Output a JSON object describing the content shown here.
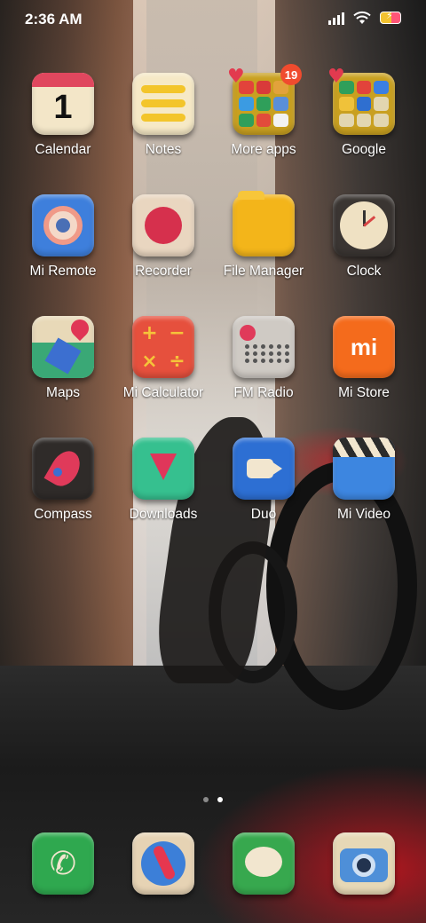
{
  "status_bar": {
    "time": "2:36 AM",
    "icons": [
      "signal-icon",
      "wifi-icon",
      "battery-charging-icon"
    ]
  },
  "home": {
    "rows": [
      [
        {
          "id": "calendar",
          "label": "Calendar",
          "icon": "calendar-icon",
          "calendar_day": "1"
        },
        {
          "id": "notes",
          "label": "Notes",
          "icon": "notes-icon"
        },
        {
          "id": "more-apps",
          "label": "More apps",
          "icon": "folder-icon",
          "badge": "19"
        },
        {
          "id": "google",
          "label": "Google",
          "icon": "folder-icon"
        }
      ],
      [
        {
          "id": "mi-remote",
          "label": "Mi Remote",
          "icon": "remote-icon"
        },
        {
          "id": "recorder",
          "label": "Recorder",
          "icon": "recorder-icon"
        },
        {
          "id": "file-manager",
          "label": "File Manager",
          "icon": "folder-files-icon"
        },
        {
          "id": "clock",
          "label": "Clock",
          "icon": "clock-icon"
        }
      ],
      [
        {
          "id": "maps",
          "label": "Maps",
          "icon": "maps-icon"
        },
        {
          "id": "mi-calculator",
          "label": "Mi Calculator",
          "icon": "calculator-icon"
        },
        {
          "id": "fm-radio",
          "label": "FM Radio",
          "icon": "radio-icon"
        },
        {
          "id": "mi-store",
          "label": "Mi Store",
          "icon": "mi-store-icon",
          "logo_text": "mi"
        }
      ],
      [
        {
          "id": "compass",
          "label": "Compass",
          "icon": "compass-icon"
        },
        {
          "id": "downloads",
          "label": "Downloads",
          "icon": "download-icon"
        },
        {
          "id": "duo",
          "label": "Duo",
          "icon": "video-call-icon"
        },
        {
          "id": "mi-video",
          "label": "Mi Video",
          "icon": "clapperboard-icon"
        }
      ]
    ]
  },
  "dock": [
    {
      "id": "phone",
      "icon": "phone-icon"
    },
    {
      "id": "browser",
      "icon": "compass-browser-icon"
    },
    {
      "id": "messaging",
      "icon": "message-icon"
    },
    {
      "id": "camera",
      "icon": "camera-icon"
    }
  ],
  "page_indicator": {
    "pages": 2,
    "current": 2
  },
  "colors": {
    "dot_inactive": "#8a8a8a",
    "dot_active": "#ffffff",
    "badge": "#f04b2e",
    "folder_heart": "#e23a4f"
  }
}
